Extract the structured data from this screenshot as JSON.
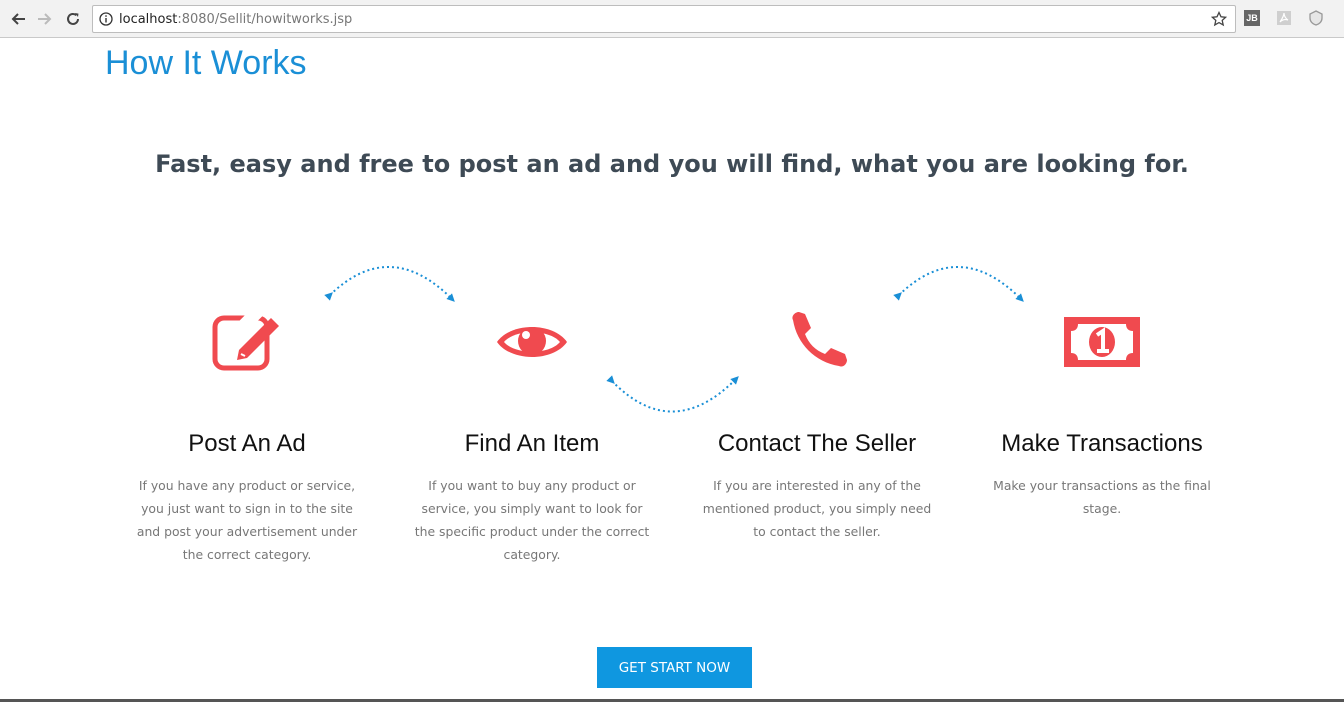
{
  "browser": {
    "url_host": "localhost",
    "url_path": ":8080/Sellit/howitworks.jsp",
    "icons": [
      "back-arrow-icon",
      "forward-arrow-icon",
      "reload-icon",
      "info-icon",
      "bookmark-star-icon",
      "jb-extension-icon",
      "pdf-extension-icon",
      "shield-extension-icon"
    ],
    "ext_jb_label": "JB"
  },
  "page": {
    "title": "How It Works",
    "tagline": "Fast, easy and free to post an ad and you will find, what you are looking for."
  },
  "steps": [
    {
      "icon": "edit-icon",
      "title": "Post An Ad",
      "description": "If you have any product or service, you just want to sign in to the site and post your advertisement under the correct category."
    },
    {
      "icon": "eye-icon",
      "title": "Find An Item",
      "description": "If you want to buy any product or service, you simply want to look for the specific product under the correct category."
    },
    {
      "icon": "phone-icon",
      "title": "Contact The Seller",
      "description": "If you are interested in any of the mentioned product, you simply need to contact the seller."
    },
    {
      "icon": "money-icon",
      "title": "Make Transactions",
      "description": "Make your transactions as the final stage."
    }
  ],
  "cta": {
    "label": "GET START NOW"
  },
  "colors": {
    "accent": "#1a8fd6",
    "icon": "#f04a4f",
    "button": "#0f97e0",
    "heading": "#3e4a55"
  }
}
